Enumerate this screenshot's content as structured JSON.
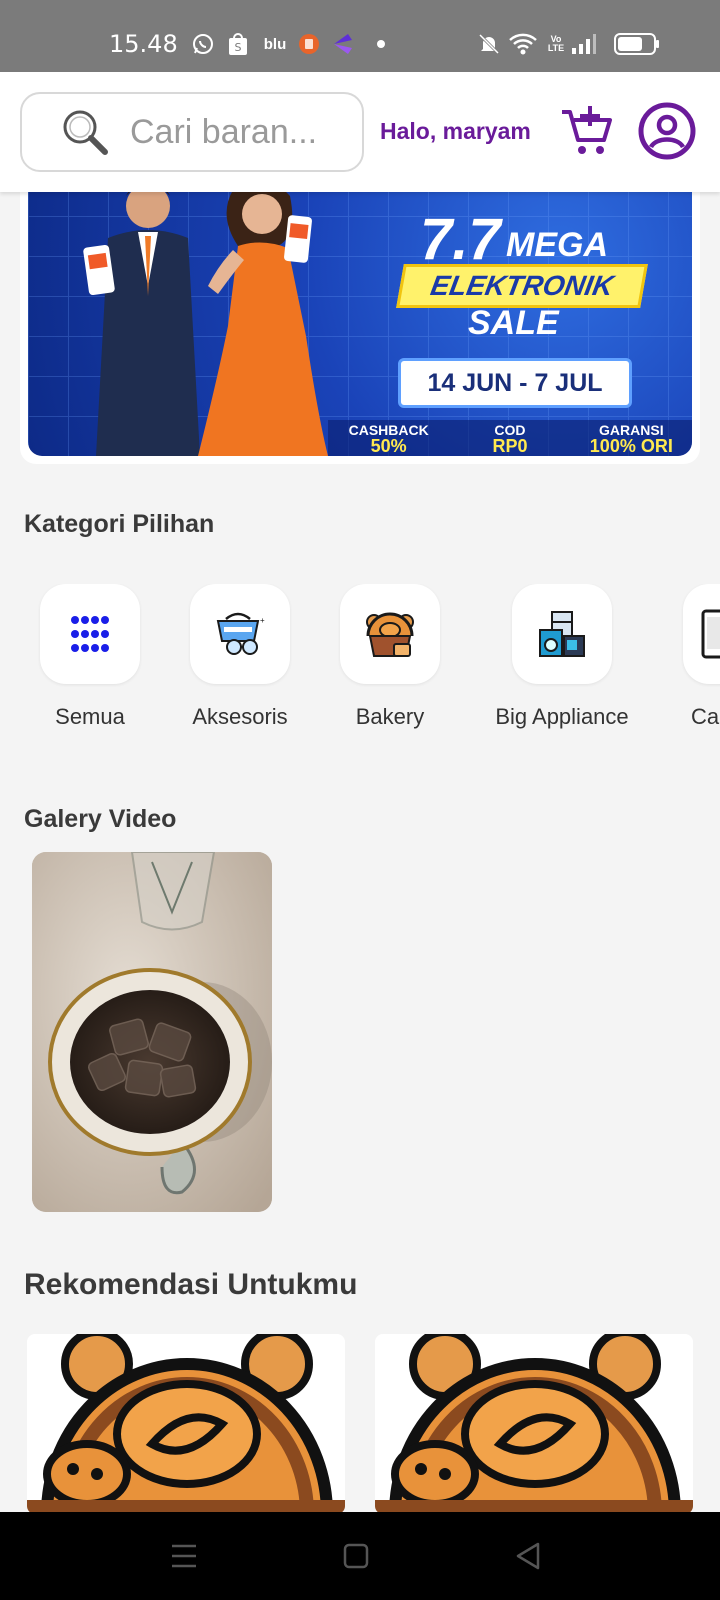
{
  "status_bar": {
    "time": "15.48",
    "icons": [
      "whatsapp-icon",
      "shopee-icon",
      "blu-icon",
      "app-orange-icon",
      "app-purple-icon",
      "dot-icon",
      "mute-icon",
      "wifi-icon",
      "volte-icon",
      "signal-icon",
      "battery-icon"
    ],
    "blu_label": "blu",
    "volte_label": "Vo LTE"
  },
  "header": {
    "search_placeholder": "Cari baran...",
    "greeting": "Halo, maryam",
    "cart_icon": "cart-plus-icon",
    "profile_icon": "user-circle-icon",
    "accent": "#6a1b9a"
  },
  "banner": {
    "big_number": "7.7",
    "mega": "MEGA",
    "elektronik": "ELEKTRONIK",
    "sale": "SALE",
    "dates": "14 JUN - 7 JUL",
    "promo": [
      {
        "top": "CASHBACK",
        "bottom": "50%"
      },
      {
        "top": "COD",
        "bottom": "RP0"
      },
      {
        "top": "GARANSI",
        "bottom": "100% ORI"
      }
    ]
  },
  "categories": {
    "title": "Kategori Pilihan",
    "items": [
      {
        "label": "Semua",
        "icon": "grid-dots-icon"
      },
      {
        "label": "Aksesoris",
        "icon": "accessories-icon"
      },
      {
        "label": "Bakery",
        "icon": "bread-basket-icon"
      },
      {
        "label": "Big Appliance",
        "icon": "appliance-icon"
      },
      {
        "label": "Ca",
        "icon": "phone-icon"
      }
    ]
  },
  "gallery": {
    "title": "Galery Video"
  },
  "recommendations": {
    "title": "Rekomendasi Untukmu"
  },
  "navbar": {
    "icons": [
      "menu-icon",
      "home-square-icon",
      "back-triangle-icon"
    ]
  }
}
